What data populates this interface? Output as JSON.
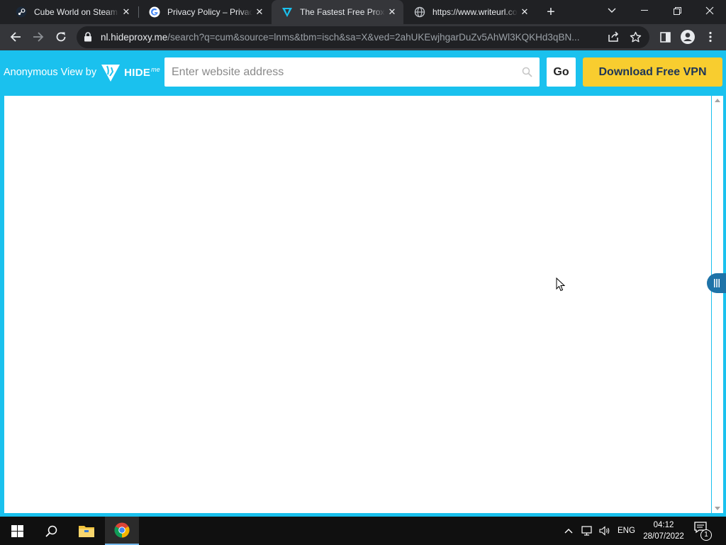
{
  "browser": {
    "tabs": [
      {
        "title": "Cube World on Steam",
        "icon": "steam-icon",
        "active": false
      },
      {
        "title": "Privacy Policy – Privacy",
        "icon": "google-icon",
        "active": false
      },
      {
        "title": "The Fastest Free Proxy",
        "icon": "hideme-icon",
        "active": true
      },
      {
        "title": "https://www.writeurl.com",
        "icon": "globe-icon",
        "active": false
      }
    ],
    "new_tab": "+",
    "url_host": "nl.hideproxy.me",
    "url_path": "/search?q=cum&source=lnms&tbm=isch&sa=X&ved=2ahUKEwjhgarDuZv5AhWl3KQKHd3qBN..."
  },
  "proxy": {
    "brand_prefix": "Anonymous View by",
    "brand_name": "HIDE",
    "brand_suffix": "me",
    "address_placeholder": "Enter website address",
    "address_value": "",
    "go_label": "Go",
    "vpn_label": "Download Free VPN",
    "accent_color": "#1ac1ee",
    "vpn_color": "#f8cd2f"
  },
  "taskbar": {
    "language": "ENG",
    "time": "04:12",
    "date": "28/07/2022",
    "notification_count": "1"
  }
}
